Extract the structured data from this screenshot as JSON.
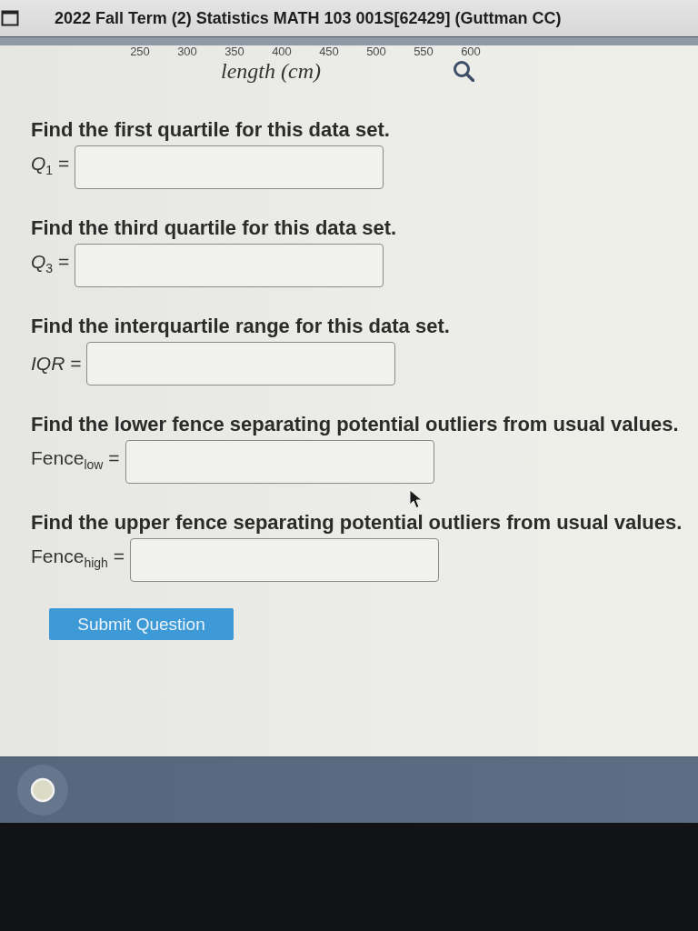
{
  "window": {
    "title": "2022 Fall Term (2) Statistics MATH 103 001S[62429] (Guttman CC)"
  },
  "axis": {
    "tick_labels": [
      "250",
      "300",
      "350",
      "400",
      "450",
      "500",
      "550",
      "600"
    ],
    "label": "length (cm)"
  },
  "questions": [
    {
      "prompt": "Find the first quartile for this data set.",
      "label": "*Q*$_{1}$ ="
    },
    {
      "prompt": "Find the third quartile for this data set.",
      "label": "*Q*$_{3}$ ="
    },
    {
      "prompt": "Find the interquartile range for this data set.",
      "label": "*IQR* ="
    },
    {
      "prompt": "Find the lower fence separating potential outliers from usual values.",
      "label": "Fence$_{low}$ ="
    },
    {
      "prompt": "Find the upper fence separating potential outliers from usual values.",
      "label": "Fence$_{high}$ ="
    }
  ],
  "submit_button": {
    "label": "Submit Question"
  }
}
